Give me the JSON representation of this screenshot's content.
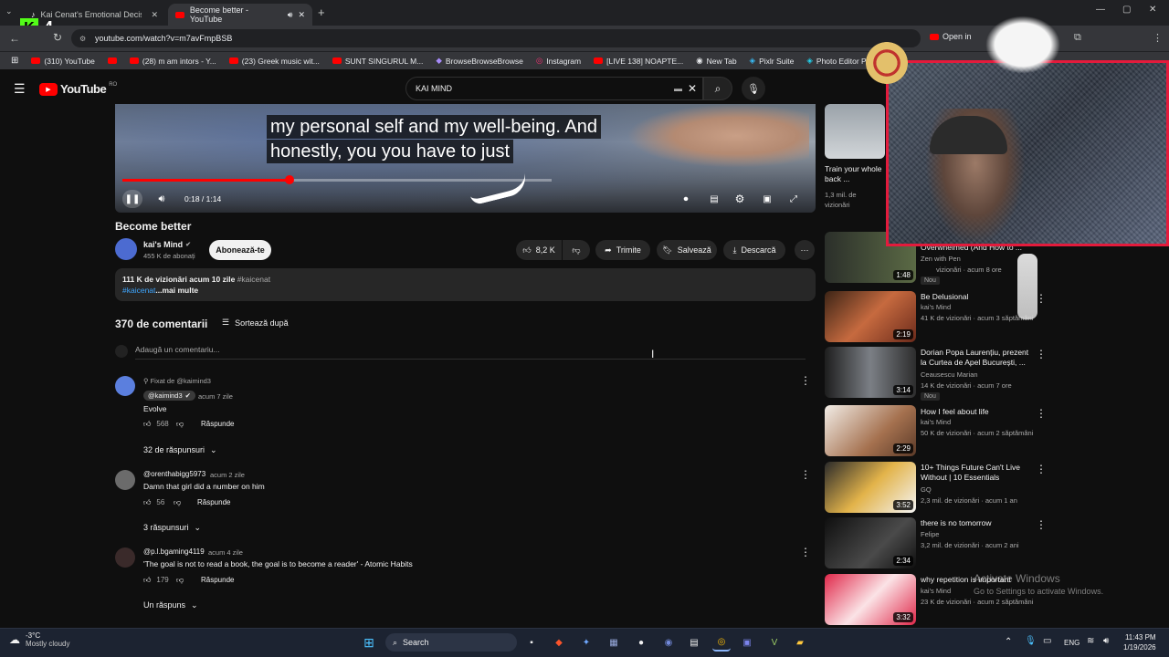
{
  "browser": {
    "tabs": [
      {
        "title": "Kai Cenat's Emotional Decision"
      },
      {
        "title": "Become better - YouTube"
      }
    ],
    "new_tab_label": "+",
    "url": "youtube.com/watch?v=m7avFmpBSB",
    "open_in_app_label": "Open in",
    "bookmarks": [
      {
        "label": "(310) YouTube"
      },
      {
        "label": ""
      },
      {
        "label": "(28) m am intors - Y..."
      },
      {
        "label": "(23) Greek music wit..."
      },
      {
        "label": "SUNT SINGURUL M..."
      },
      {
        "label": "BrowseBrowseBrowse"
      },
      {
        "label": "Instagram"
      },
      {
        "label": "[LIVE 138] NOAPTE..."
      },
      {
        "label": "New Tab"
      },
      {
        "label": "Pixlr Suite"
      },
      {
        "label": "Photo Editor Pixlr"
      }
    ],
    "overlay_logo_text": "4"
  },
  "youtube": {
    "logo_text": "YouTube",
    "region": "RO",
    "search_value": "KAI MIND",
    "player": {
      "caption_line1": "my personal self and my well-being. And",
      "caption_line2": "honestly, you you have to just",
      "time": "0:18 / 1:14",
      "progress_fraction": 0.39
    },
    "video": {
      "title": "Become better",
      "channel": "kai's Mind",
      "subscribers": "455 K de abonați",
      "subscribe_label": "Abonează-te",
      "likes": "8,2 K",
      "share_label": "Trimite",
      "save_label": "Salvează",
      "download_label": "Descarcă",
      "views_age": "111 K de vizionări  acum 10 zile",
      "hashtag1": "#kaicenat",
      "hashtag2": "#kaicenat",
      "more_label": "...mai multe"
    },
    "comments": {
      "count_label": "370 de comentarii",
      "sort_label": "Sortează după",
      "add_placeholder": "Adaugă un comentariu...",
      "items": [
        {
          "pinned": "Fixat de @kaimind3",
          "author": "@kaimind3",
          "age": "acum 7 zile",
          "text": "Evolve",
          "likes": "568",
          "reply": "Răspunde",
          "replies": "32 de răspunsuri"
        },
        {
          "author": "@orenthabigg5973",
          "age": "acum 2 zile",
          "text": "Damn that girl did a number on him",
          "likes": "56",
          "reply": "Răspunde",
          "replies": "3 răspunsuri"
        },
        {
          "author": "@p.l.bgaming4119",
          "age": "acum 4 zile",
          "text": "'The goal is not to read a book, the goal is to become a reader' - Atomic Habits",
          "likes": "179",
          "reply": "Răspunde",
          "replies": "Un răspuns"
        }
      ]
    },
    "related": [
      {
        "title": "Train your whole back ...",
        "meta1": "1,3 mil. de",
        "meta2": "vizionări",
        "duration": ""
      },
      {
        "title": "Overwhelmed (And How to ...",
        "channel": "Zen with Pen",
        "meta": "vizionări · acum 8 ore",
        "badge": "Nou",
        "duration": "1:48"
      },
      {
        "title": "Be Delusional",
        "channel": "kai's Mind",
        "meta": "41 K de vizionări · acum 3 săptămâni",
        "duration": "2:19"
      },
      {
        "title": "Dorian Popa Laurențiu, prezent la Curtea de Apel București, ...",
        "channel": "Ceausescu Marian",
        "meta": "14 K de vizionări · acum 7 ore",
        "badge": "Nou",
        "duration": "3:14"
      },
      {
        "title": "How I feel about life",
        "channel": "kai's Mind",
        "meta": "50 K de vizionări · acum 2 săptămâni",
        "duration": "2:29"
      },
      {
        "title": "10+ Things Future Can't Live Without | 10 Essentials",
        "channel": "GQ",
        "meta": "2,3 mil. de vizionări · acum 1 an",
        "duration": "3:52"
      },
      {
        "title": "there is no tomorrow",
        "channel": "Felipe",
        "meta": "3,2 mil. de vizionări · acum 2 ani",
        "duration": "2:34"
      },
      {
        "title": "why repetition is important",
        "channel": "kai's Mind",
        "meta": "23 K de vizionări · acum 2 săptămâni",
        "duration": "3:32"
      }
    ]
  },
  "windows": {
    "watermark_title": "Activate Windows",
    "watermark_sub": "Go to Settings to activate Windows.",
    "weather_temp": "-3°C",
    "weather_desc": "Mostly cloudy",
    "search_label": "Search",
    "lang": "ENG",
    "time": "11:43 PM",
    "date": "1/19/2026"
  },
  "colors": {
    "accent": "#ff0000",
    "cam_border": "#e31b3c",
    "background": "#0f0f0f"
  }
}
